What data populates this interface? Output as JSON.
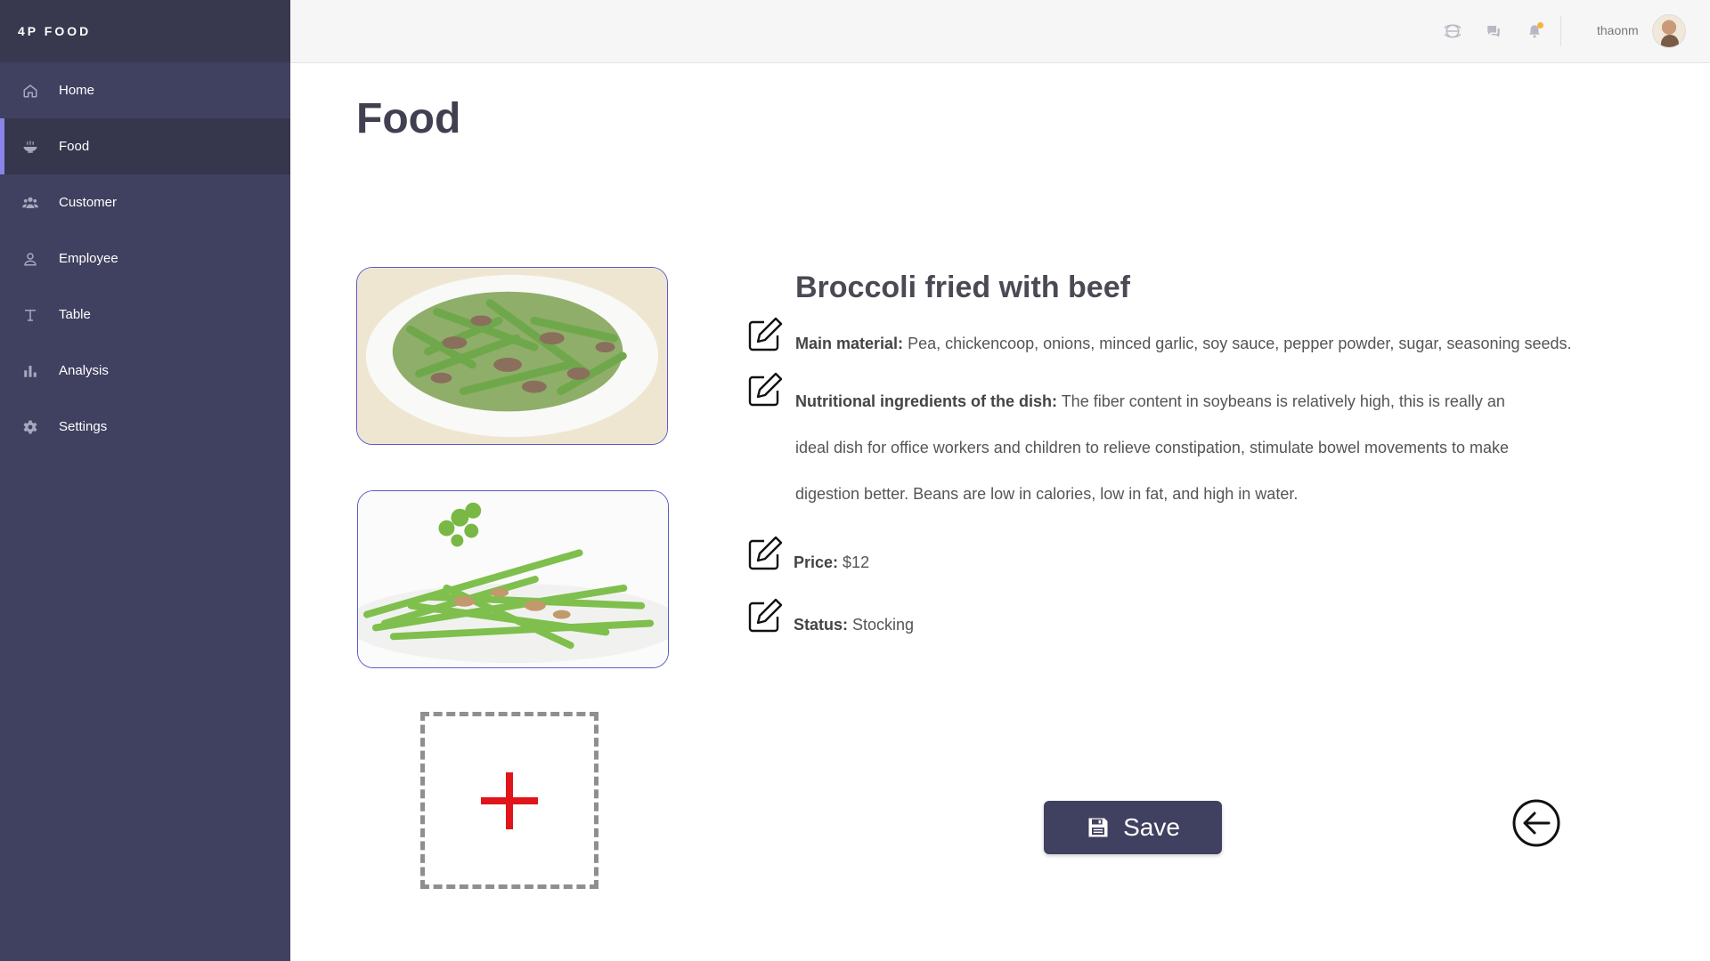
{
  "app": {
    "brand": "4P FOOD"
  },
  "sidebar": {
    "items": [
      {
        "label": "Home",
        "icon": "home-icon",
        "active": false
      },
      {
        "label": "Food",
        "icon": "bowl-icon",
        "active": true
      },
      {
        "label": "Customer",
        "icon": "users-icon",
        "active": false
      },
      {
        "label": "Employee",
        "icon": "user-icon",
        "active": false
      },
      {
        "label": "Table",
        "icon": "text-icon",
        "active": false
      },
      {
        "label": "Analysis",
        "icon": "bar-chart-icon",
        "active": false
      },
      {
        "label": "Settings",
        "icon": "gear-icon",
        "active": false
      }
    ]
  },
  "topbar": {
    "username": "thaonm",
    "icons": [
      "globe-icon",
      "chat-icon",
      "bell-icon"
    ]
  },
  "page": {
    "title": "Food"
  },
  "food": {
    "name": "Broccoli fried with beef",
    "main_material_label": "Main material:",
    "main_material": "Pea, chickencoop, onions, minced garlic, soy sauce, pepper powder, sugar, seasoning seeds.",
    "nutrition_label": "Nutritional ingredients of the dish:",
    "nutrition": "The fiber content in soybeans is relatively high, this is really an ideal dish for office workers and children to relieve constipation, stimulate bowel movements to make digestion better. Beans are low in calories, low in fat, and high in water.",
    "price_label": "Price:",
    "price": "$12",
    "status_label": "Status:",
    "status": "Stocking"
  },
  "actions": {
    "save_label": "Save"
  },
  "colors": {
    "sidebar": "#404060",
    "accent": "#8a84e8",
    "add": "#e0151b",
    "notification": "#f6b23a"
  }
}
